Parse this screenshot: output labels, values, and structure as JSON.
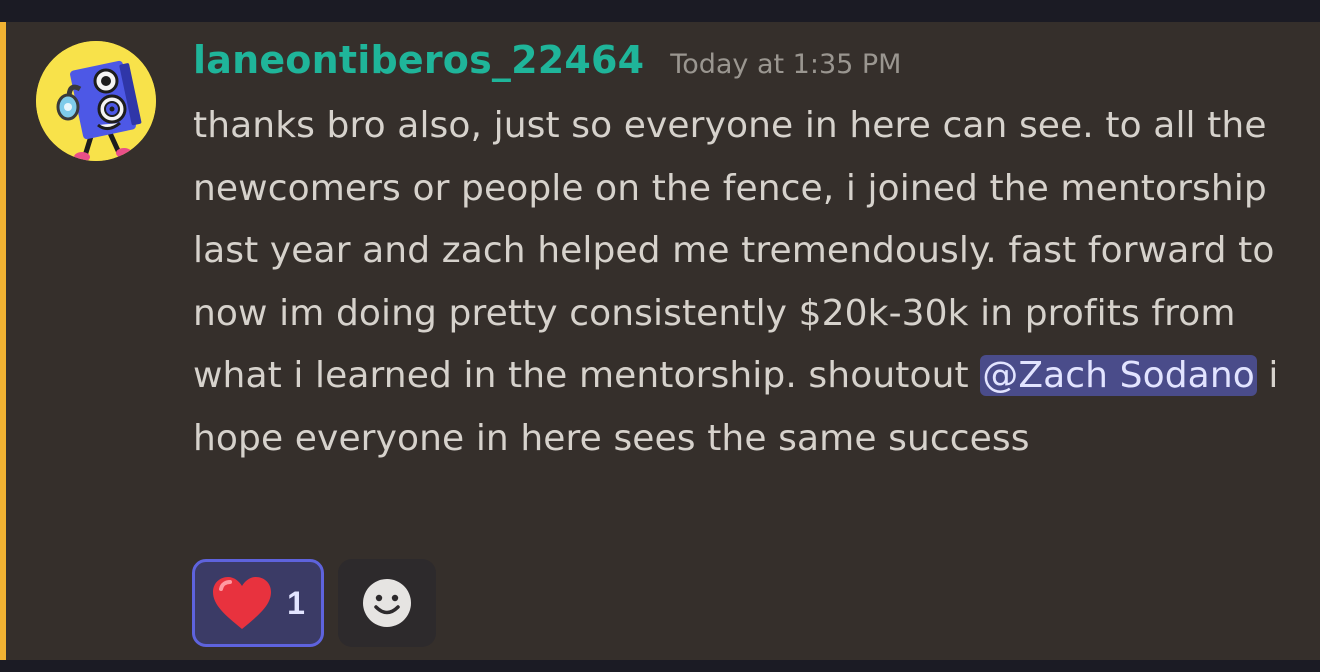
{
  "message": {
    "author": {
      "username": "laneontiberos_22464",
      "avatar": "cartoon-speaker-avatar"
    },
    "timestamp": "Today at 1:35 PM",
    "content": {
      "before_mention": "thanks bro also, just so everyone in here can see. to all the newcomers or people on the fence, i joined the mentorship last year and zach helped me tremendously. fast forward to now im doing pretty consistently $20k-30k in profits from what i learned in the mentorship. shoutout ",
      "mention": "@Zach Sodano",
      "after_mention": " i hope everyone in here sees the same success"
    },
    "reactions": [
      {
        "emoji": "heart-emoji",
        "count": "1",
        "reacted": true
      }
    ],
    "add_reaction_icon": "smiley-icon"
  },
  "colors": {
    "highlight": "#f0b232",
    "username": "#1fb59a",
    "mention_bg": "#4a4c8a",
    "reaction_border": "#5e63dd"
  }
}
